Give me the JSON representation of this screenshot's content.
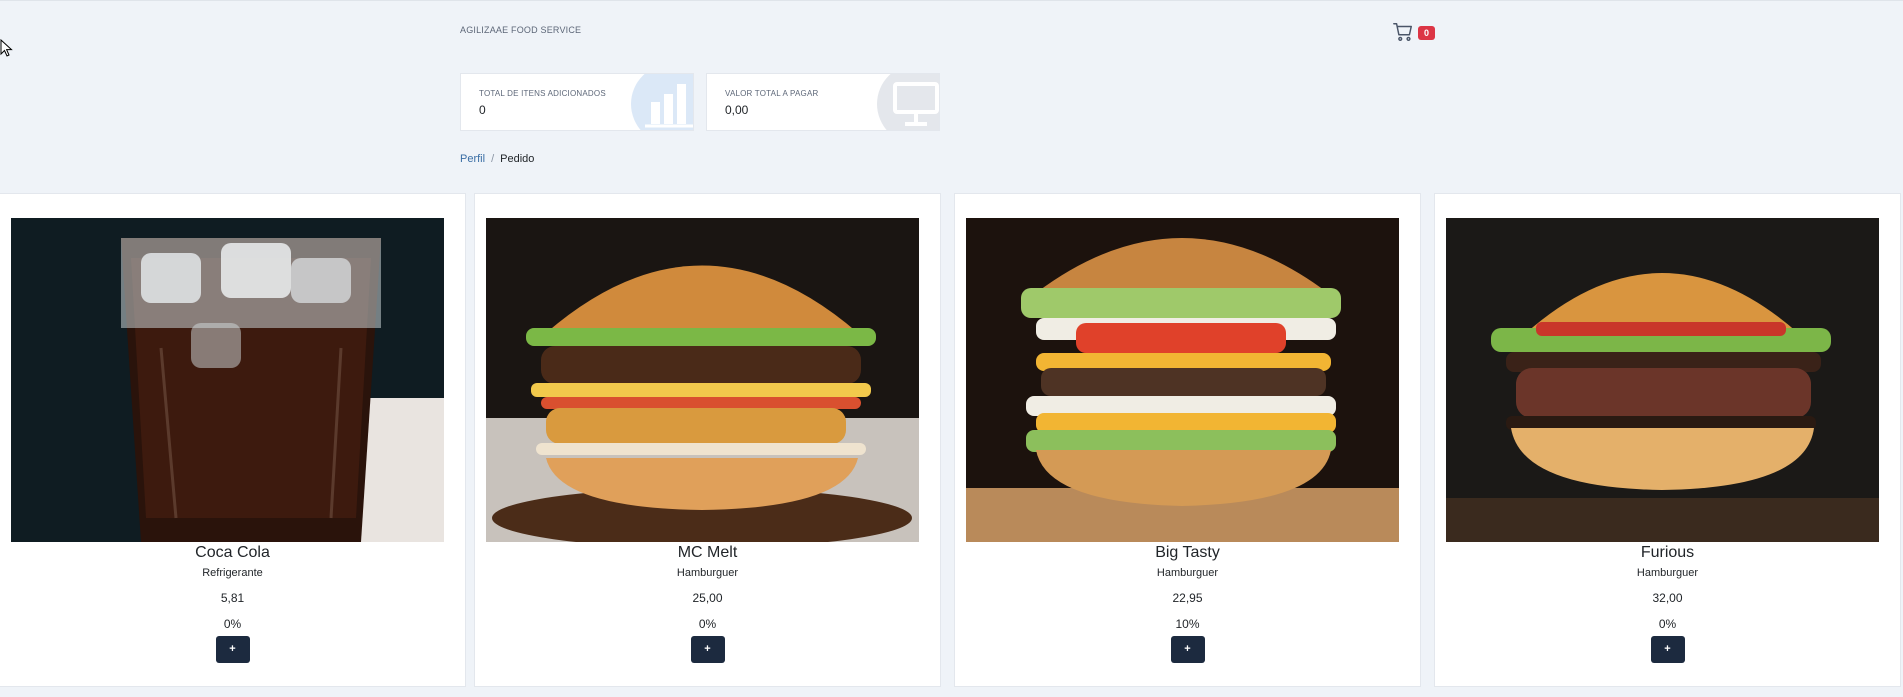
{
  "header": {
    "brand": "AGILIZAAE FOOD SERVICE",
    "cart_count": "0",
    "cart_icon": "shopping-cart-icon"
  },
  "stats": [
    {
      "label": "TOTAL DE ITENS ADICIONADOS",
      "value": "0",
      "icon": "bar-chart-icon"
    },
    {
      "label": "VALOR TOTAL A PAGAR",
      "value": "0,00",
      "icon": "monitor-icon"
    }
  ],
  "breadcrumb": {
    "link": "Perfil",
    "separator": "/",
    "current": "Pedido"
  },
  "products": [
    {
      "name": "Coca Cola",
      "category": "Refrigerante",
      "price": "5,81",
      "discount": "0%",
      "add_label": "+"
    },
    {
      "name": "MC Melt",
      "category": "Hamburguer",
      "price": "25,00",
      "discount": "0%",
      "add_label": "+"
    },
    {
      "name": "Big Tasty",
      "category": "Hamburguer",
      "price": "22,95",
      "discount": "10%",
      "add_label": "+"
    },
    {
      "name": "Furious",
      "category": "Hamburguer",
      "price": "32,00",
      "discount": "0%",
      "add_label": "+"
    }
  ],
  "colors": {
    "page_bg": "#eff3f8",
    "button_bg": "#1c2a3f",
    "badge_bg": "#dc3545",
    "link": "#3a6ea5"
  }
}
